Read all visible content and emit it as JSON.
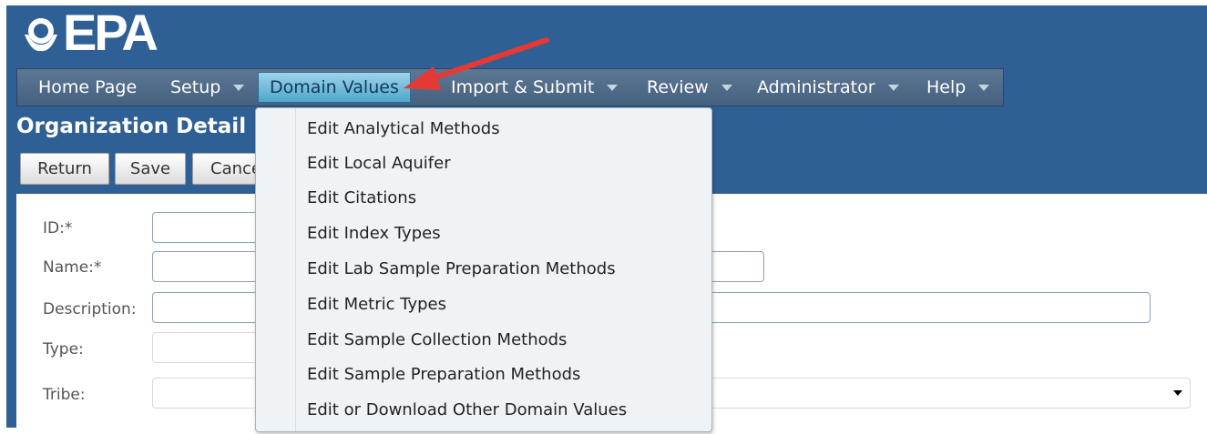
{
  "brand": {
    "logo_text": "EPA"
  },
  "nav": {
    "items": [
      {
        "label": "Home Page"
      },
      {
        "label": "Setup"
      },
      {
        "label": "Domain Values"
      },
      {
        "label": "Import & Submit"
      },
      {
        "label": "Review"
      },
      {
        "label": "Administrator"
      },
      {
        "label": "Help"
      }
    ],
    "active_index": 2
  },
  "page": {
    "title": "Organization Detail"
  },
  "toolbar": {
    "return_label": "Return",
    "save_label": "Save",
    "cancel_label": "Cancel"
  },
  "form": {
    "fields": [
      {
        "label": "ID:*",
        "value": ""
      },
      {
        "label": "Name:*",
        "value": ""
      },
      {
        "label": "Description:",
        "value": ""
      },
      {
        "label": "Type:",
        "value": ""
      },
      {
        "label": "Tribe:",
        "value": ""
      }
    ]
  },
  "domain_menu": {
    "items": [
      {
        "label": "Edit Analytical Methods"
      },
      {
        "label": "Edit Local Aquifer"
      },
      {
        "label": "Edit Citations"
      },
      {
        "label": "Edit Index Types"
      },
      {
        "label": "Edit Lab Sample Preparation Methods"
      },
      {
        "label": "Edit Metric Types"
      },
      {
        "label": "Edit Sample Collection Methods"
      },
      {
        "label": "Edit Sample Preparation Methods"
      },
      {
        "label": "Edit or Download Other Domain Values"
      }
    ]
  },
  "colors": {
    "header_bg": "#2f6095",
    "nav_bg": "#516c8a",
    "active_tab": "#6dbcde",
    "annotation_arrow": "#e53935"
  },
  "icons": {
    "logo": "epa-logo-icon",
    "dropdown": "chevron-down-icon",
    "annotation": "red-arrow-annotation"
  }
}
